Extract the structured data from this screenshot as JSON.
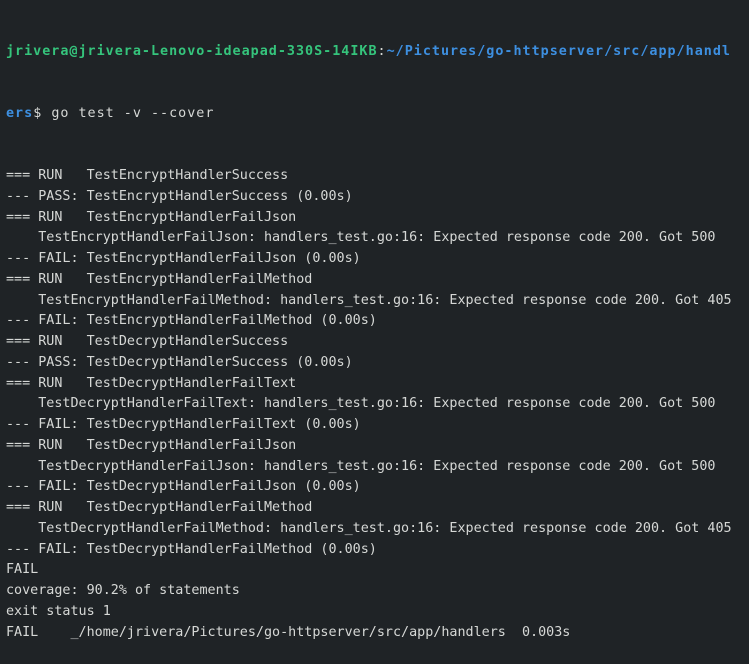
{
  "prompt": {
    "user_host": "jrivera@jrivera-Lenovo-ideapad-330S-14IKB",
    "separator": ":",
    "path_part1": "~/Pictures/go-httpserver/src/app/handl",
    "path_part2": "ers",
    "symbol": "$ ",
    "command": "go test -v --cover"
  },
  "colors": {
    "background": "#1f2326",
    "text": "#d6d8d6",
    "user": "#35c47c",
    "path": "#3d8fe0"
  },
  "output": [
    "=== RUN   TestEncryptHandlerSuccess",
    "--- PASS: TestEncryptHandlerSuccess (0.00s)",
    "=== RUN   TestEncryptHandlerFailJson",
    "    TestEncryptHandlerFailJson: handlers_test.go:16: Expected response code 200. Got 500",
    "--- FAIL: TestEncryptHandlerFailJson (0.00s)",
    "=== RUN   TestEncryptHandlerFailMethod",
    "    TestEncryptHandlerFailMethod: handlers_test.go:16: Expected response code 200. Got 405",
    "--- FAIL: TestEncryptHandlerFailMethod (0.00s)",
    "=== RUN   TestDecryptHandlerSuccess",
    "--- PASS: TestDecryptHandlerSuccess (0.00s)",
    "=== RUN   TestDecryptHandlerFailText",
    "    TestDecryptHandlerFailText: handlers_test.go:16: Expected response code 200. Got 500",
    "--- FAIL: TestDecryptHandlerFailText (0.00s)",
    "=== RUN   TestDecryptHandlerFailJson",
    "    TestDecryptHandlerFailJson: handlers_test.go:16: Expected response code 200. Got 500",
    "--- FAIL: TestDecryptHandlerFailJson (0.00s)",
    "=== RUN   TestDecryptHandlerFailMethod",
    "    TestDecryptHandlerFailMethod: handlers_test.go:16: Expected response code 200. Got 405",
    "--- FAIL: TestDecryptHandlerFailMethod (0.00s)",
    "FAIL",
    "coverage: 90.2% of statements",
    "exit status 1",
    "FAIL\t_/home/jrivera/Pictures/go-httpserver/src/app/handlers  0.003s"
  ]
}
